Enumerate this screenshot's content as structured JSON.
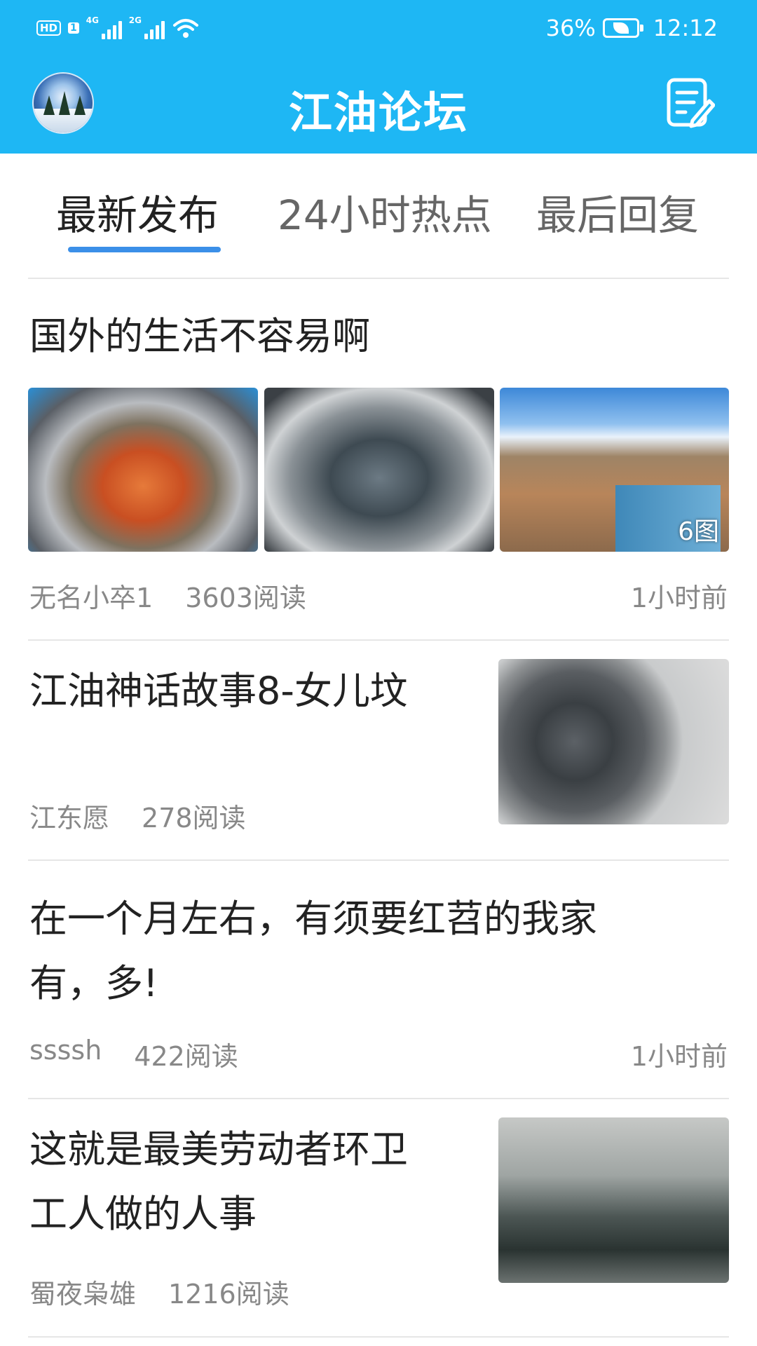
{
  "status_bar": {
    "hd_label": "HD",
    "sim_label": "1",
    "network1": "4G",
    "network2": "2G",
    "battery_percent": "36%",
    "time": "12:12"
  },
  "header": {
    "title": "江油论坛",
    "avatar_icon": "user-avatar",
    "compose_icon": "edit-icon"
  },
  "tabs": [
    {
      "label": "最新发布",
      "active": true
    },
    {
      "label": "24小时热点",
      "active": false
    },
    {
      "label": "最后回复",
      "active": false
    }
  ],
  "posts": [
    {
      "title": "国外的生活不容易啊",
      "author": "无名小卒1",
      "reads": "3603阅读",
      "time": "1小时前",
      "image_count": "6图"
    },
    {
      "title": "江油神话故事8-女儿坟",
      "author": "江东愿",
      "reads": "278阅读",
      "time": ""
    },
    {
      "title_line1": "在一个月左右，有须要红苕的我家",
      "title_line2": "有，多!",
      "author": "ssssh",
      "reads": "422阅读",
      "time": "1小时前"
    },
    {
      "title_line1": "这就是最美劳动者环卫",
      "title_line2": "工人做的人事",
      "author": "蜀夜枭雄",
      "reads": "1216阅读",
      "time": ""
    }
  ],
  "colors": {
    "header_bg": "#1eb7f4",
    "tab_indicator": "#3b8fe8"
  }
}
